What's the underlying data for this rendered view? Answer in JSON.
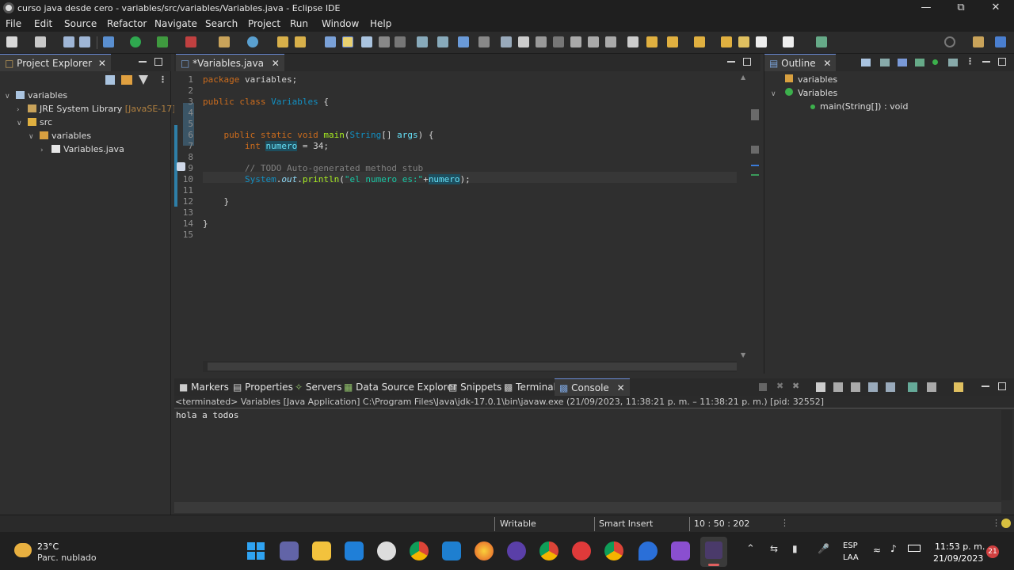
{
  "window": {
    "title": "curso java desde cero - variables/src/variables/Variables.java - Eclipse IDE"
  },
  "menu": [
    "File",
    "Edit",
    "Source",
    "Refactor",
    "Navigate",
    "Search",
    "Project",
    "Run",
    "Window",
    "Help"
  ],
  "project_explorer": {
    "tab_label": "Project Explorer",
    "tree": [
      {
        "label": "variables",
        "indent": 0,
        "icon": "project-icon",
        "expanded": true
      },
      {
        "label": "JRE System Library",
        "suffix": "[JavaSE-17]",
        "indent": 1,
        "icon": "library-icon",
        "expanded": false
      },
      {
        "label": "src",
        "indent": 1,
        "icon": "folder-icon",
        "expanded": true
      },
      {
        "label": "variables",
        "indent": 2,
        "icon": "package-icon",
        "expanded": true
      },
      {
        "label": "Variables.java",
        "indent": 3,
        "icon": "java-file-icon",
        "expanded": false
      }
    ]
  },
  "editor": {
    "tab_label": "*Variables.java",
    "lines": [
      {
        "n": "1",
        "code": [
          [
            "kw",
            "package"
          ],
          [
            "",
            " variables;"
          ]
        ]
      },
      {
        "n": "2",
        "code": []
      },
      {
        "n": "3",
        "code": [
          [
            "kw",
            "public"
          ],
          [
            "",
            " "
          ],
          [
            "kw",
            "class"
          ],
          [
            "",
            " "
          ],
          [
            "cls",
            "Variables"
          ],
          [
            "",
            " {"
          ]
        ]
      },
      {
        "n": "4",
        "code": []
      },
      {
        "n": "5",
        "code": []
      },
      {
        "n": "6",
        "code": [
          [
            "",
            "    "
          ],
          [
            "kw",
            "public"
          ],
          [
            "",
            " "
          ],
          [
            "kw",
            "static"
          ],
          [
            "",
            " "
          ],
          [
            "kw",
            "void"
          ],
          [
            "",
            " "
          ],
          [
            "meth",
            "main"
          ],
          [
            "",
            "("
          ],
          [
            "cls",
            "String"
          ],
          [
            "",
            "[] "
          ],
          [
            "var",
            "args"
          ],
          [
            "",
            ") {"
          ]
        ]
      },
      {
        "n": "7",
        "code": [
          [
            "",
            "        "
          ],
          [
            "kw",
            "int"
          ],
          [
            "",
            " "
          ],
          [
            "var",
            "numero"
          ],
          [
            "",
            " = 34;"
          ]
        ]
      },
      {
        "n": "8",
        "code": []
      },
      {
        "n": "9",
        "code": [
          [
            "",
            "        "
          ],
          [
            "cmt",
            "// TODO Auto-generated method stub"
          ]
        ]
      },
      {
        "n": "10",
        "code": [
          [
            "",
            "        "
          ],
          [
            "cls",
            "System"
          ],
          [
            "",
            "."
          ],
          [
            "field",
            "out"
          ],
          [
            "",
            "."
          ],
          [
            "meth",
            "println"
          ],
          [
            "",
            "("
          ],
          [
            "str",
            "\"el numero es:\""
          ],
          [
            "",
            "+"
          ],
          [
            "var",
            "numero"
          ],
          [
            "",
            ");"
          ]
        ]
      },
      {
        "n": "11",
        "code": []
      },
      {
        "n": "12",
        "code": [
          [
            "",
            "    }"
          ]
        ]
      },
      {
        "n": "13",
        "code": []
      },
      {
        "n": "14",
        "code": [
          [
            "",
            "}"
          ]
        ]
      },
      {
        "n": "15",
        "code": []
      }
    ]
  },
  "outline": {
    "tab_label": "Outline",
    "items": [
      {
        "label": "variables",
        "indent": 0,
        "icon": "package-icon"
      },
      {
        "label": "Variables",
        "indent": 0,
        "icon": "class-icon"
      },
      {
        "label": "main(String[]) : void",
        "indent": 1,
        "icon": "method-icon"
      }
    ]
  },
  "bottom_tabs": [
    "Markers",
    "Properties",
    "Servers",
    "Data Source Explorer",
    "Snippets",
    "Terminal",
    "Console"
  ],
  "console": {
    "header": "<terminated> Variables [Java Application] C:\\Program Files\\Java\\jdk-17.0.1\\bin\\javaw.exe  (21/09/2023, 11:38:21 p. m. – 11:38:21 p. m.) [pid: 32552]",
    "output": "hola a todos"
  },
  "statusbar": {
    "writable": "Writable",
    "insert_mode": "Smart Insert",
    "position": "10 : 50 : 202"
  },
  "taskbar": {
    "weather_temp": "23°C",
    "weather_desc": "Parc. nublado",
    "lang1": "ESP",
    "lang2": "LAA",
    "time": "11:53 p. m.",
    "date": "21/09/2023",
    "notif_count": "21"
  }
}
